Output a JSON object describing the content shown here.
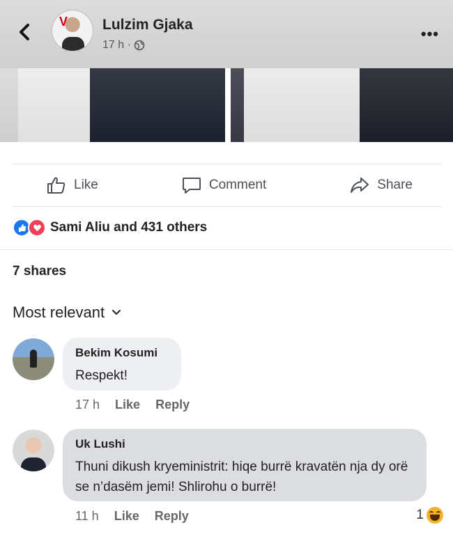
{
  "header": {
    "author_name": "Lulzim Gjaka",
    "post_time": "17 h ·",
    "avatar_mark": "V",
    "more_label": "•••"
  },
  "actions": {
    "like_label": "Like",
    "comment_label": "Comment",
    "share_label": "Share"
  },
  "reactions": {
    "summary": "Sami Aliu and 431 others",
    "types": [
      "like-icon",
      "love-icon"
    ],
    "like_color": "#1877f2",
    "love_color": "#f33e58"
  },
  "shares": {
    "label": "7 shares"
  },
  "sort": {
    "label": "Most relevant"
  },
  "comments": [
    {
      "author": "Bekim Kosumi",
      "text": "Respekt!",
      "time": "17 h",
      "like_label": "Like",
      "reply_label": "Reply"
    },
    {
      "author": "Uk Lushi",
      "text": "Thuni dikush kryeministrit: hiqe burrë kravatën nja dy orë se n’dasëm jemi! Shlirohu o burrë!",
      "time": "11 h",
      "like_label": "Like",
      "reply_label": "Reply",
      "reaction_count": "1",
      "reaction_type": "haha-icon"
    }
  ]
}
